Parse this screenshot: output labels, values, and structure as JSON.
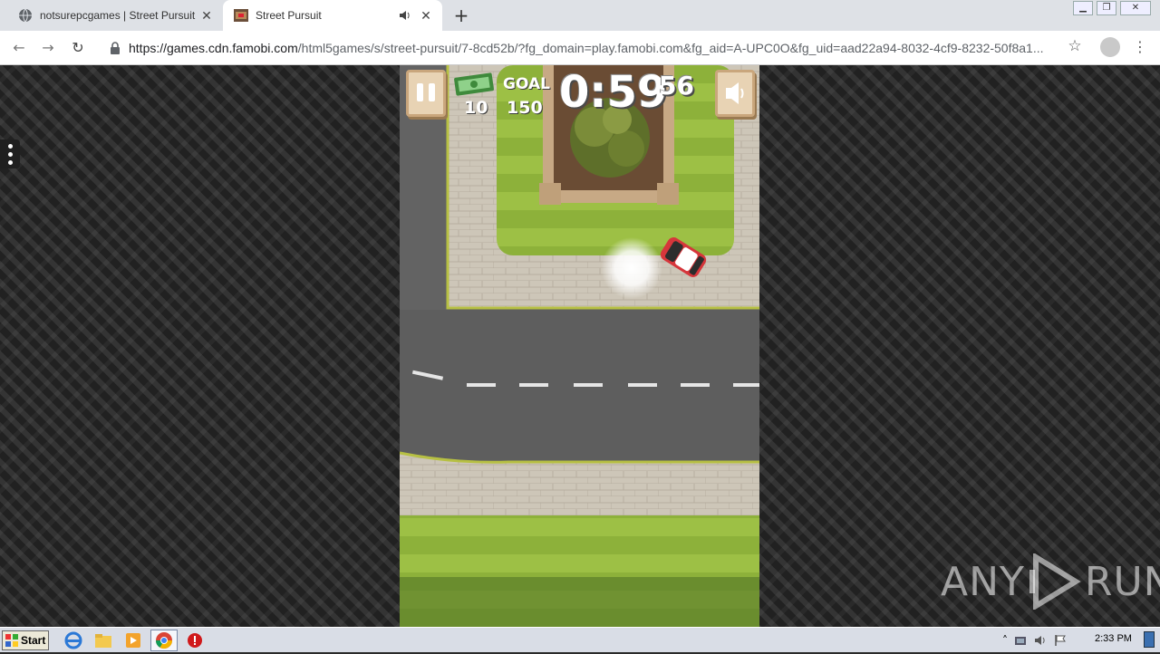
{
  "browser": {
    "tabs": [
      {
        "title": "notsurepcgames | Street Pursuit",
        "active": false
      },
      {
        "title": "Street Pursuit",
        "active": true
      }
    ],
    "new_tab_label": "+",
    "url_host": "https://games.cdn.famobi.com",
    "url_path": "/html5games/s/street-pursuit/7-8cd52b/?fg_domain=play.famobi.com&fg_aid=A-UPC0O&fg_uid=aad22a94-8032-4cf9-8232-50f8a1..."
  },
  "game": {
    "money_value": "10",
    "goal_label": "GOAL",
    "goal_value": "150",
    "timer_main": "0:59",
    "timer_fraction": "56"
  },
  "watermark": {
    "left": "ANY",
    "right": "RUN"
  },
  "taskbar": {
    "start_label": "Start",
    "clock": "2:33 PM"
  },
  "colors": {
    "road": "#5e5e5e",
    "grass": "#8fb43c",
    "sidewalk": "#cbc4b6",
    "car": "#d6363b"
  }
}
